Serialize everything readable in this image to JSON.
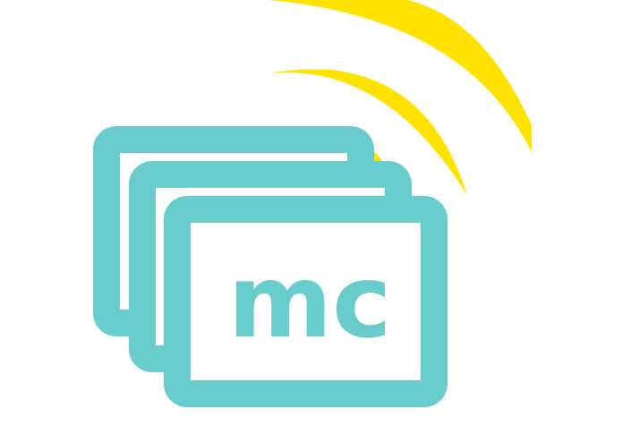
{
  "logo": {
    "text": "mc",
    "icon": "stacked-cards-with-signal-icon",
    "colors": {
      "teal": "#67CCCB",
      "yellow": "#FFE200",
      "background": "#FFFFFF"
    }
  }
}
